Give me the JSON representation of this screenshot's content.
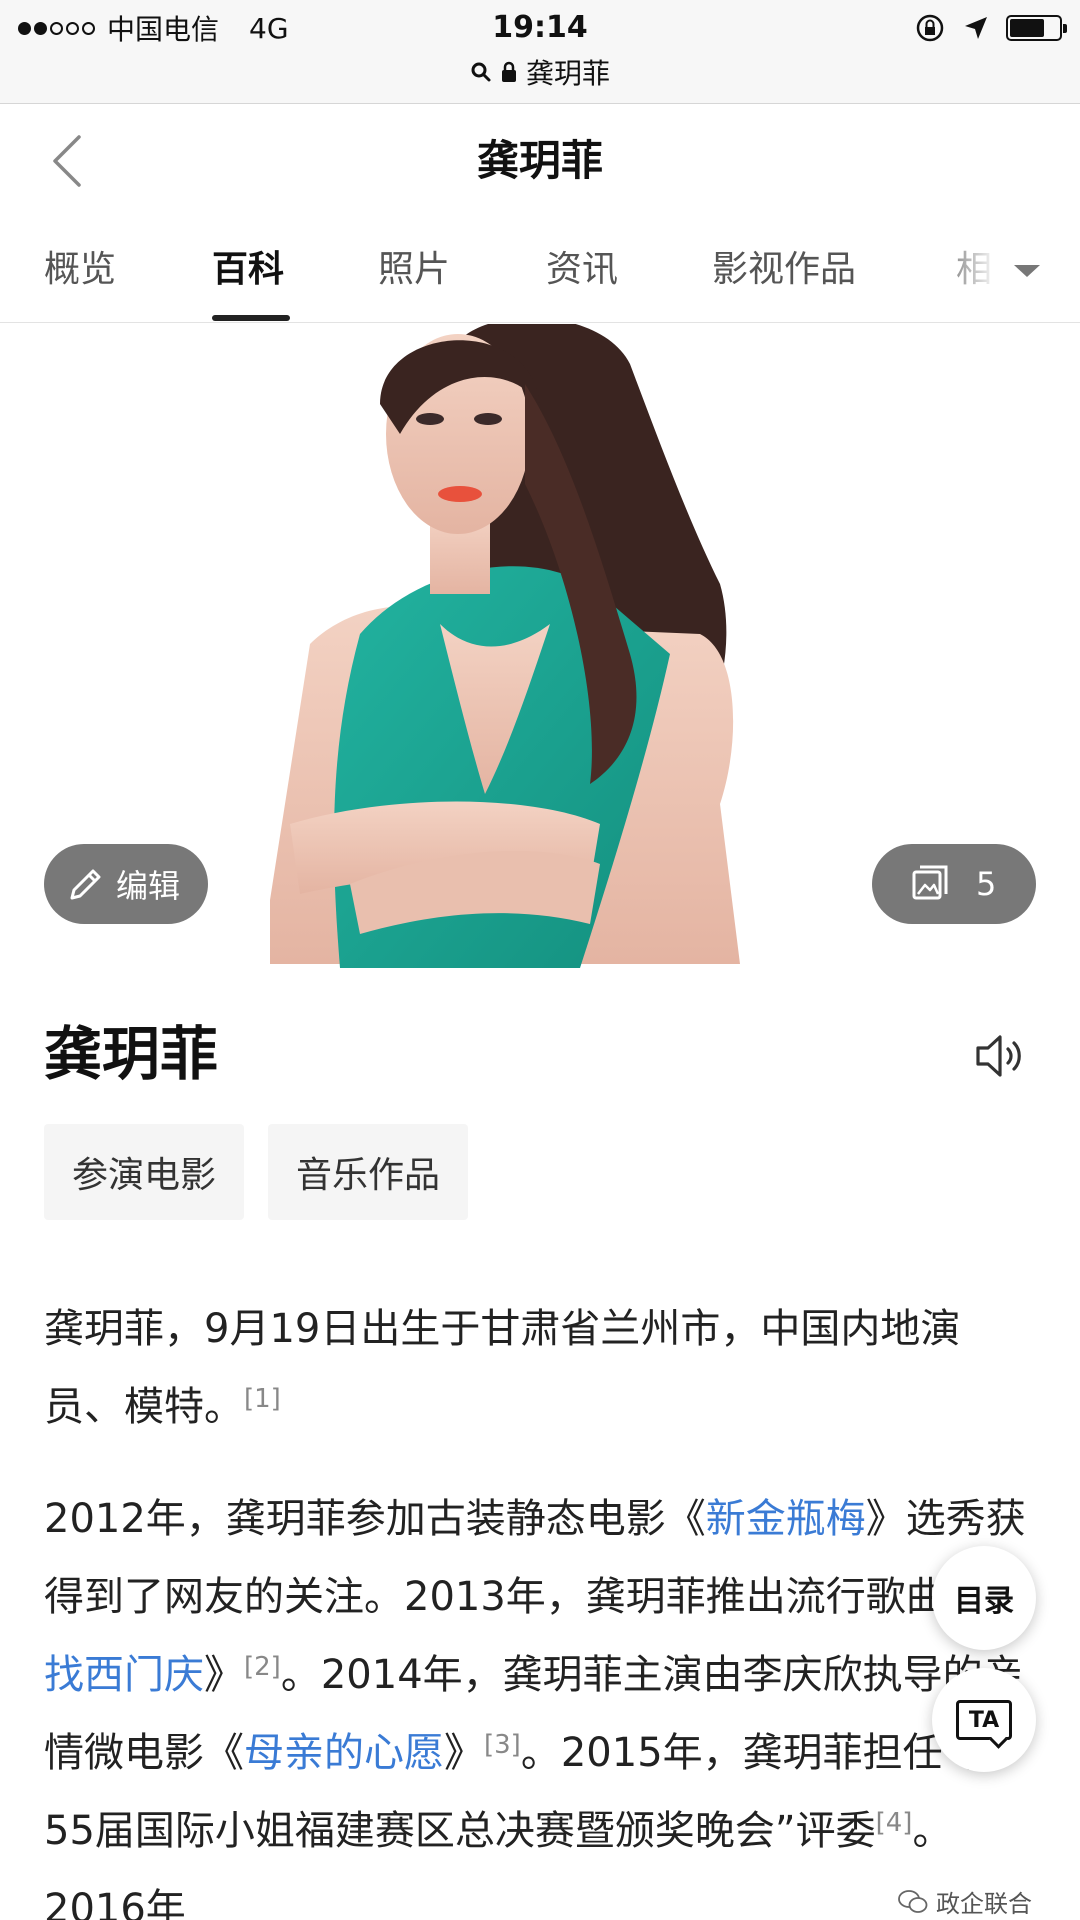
{
  "status_bar": {
    "carrier": "中国电信",
    "network": "4G",
    "time": "19:14",
    "battery_level": 0.7
  },
  "address_bar": {
    "text": "龚玥菲"
  },
  "nav": {
    "title": "龚玥菲"
  },
  "tabs": [
    {
      "label": "概览",
      "active": false
    },
    {
      "label": "百科",
      "active": true
    },
    {
      "label": "照片",
      "active": false
    },
    {
      "label": "资讯",
      "active": false
    },
    {
      "label": "影视作品",
      "active": false
    },
    {
      "label": "相",
      "active": false
    }
  ],
  "hero": {
    "edit_label": "编辑",
    "photo_count": "5"
  },
  "entry": {
    "title": "龚玥菲",
    "chips": [
      "参演电影",
      "音乐作品"
    ]
  },
  "article": {
    "p1_text": "龚玥菲，9月19日出生于甘肃省兰州市，中国内地演员、模特。",
    "p1_ref": "[1]",
    "p2": {
      "t1": "2012年，龚玥菲参加古装静态电影《",
      "l1": "新金瓶梅",
      "t2": "》选秀获得到了网友的关注。2013年，龚玥菲推出流行歌曲《",
      "l2": "寻找西门庆",
      "t3": "》",
      "r2": "[2]",
      "t4": "。2014年，龚玥菲主演由李庆欣执导的亲情微电影《",
      "l3": "母亲的心愿",
      "t5": "》",
      "r3": "[3]",
      "t6": "。2015年，龚玥菲担任“第55届国际小姐福建赛区总决赛暨颁奖晚会”评委",
      "r4": "[4]",
      "t7": "。2016年"
    }
  },
  "floating": {
    "toc_label": "目录",
    "ta_label": "TA"
  },
  "watermark": {
    "text": "政企联合"
  },
  "colors": {
    "link": "#3a7bd5",
    "pill_bg": "#5a5a5a",
    "chip_bg": "#f5f5f5",
    "dress_teal": "#1fae9a"
  },
  "icons": [
    "search-icon",
    "lock-icon",
    "back-arrow-icon",
    "pencil-icon",
    "gallery-icon",
    "speaker-icon",
    "chevron-down-icon",
    "wechat-icon",
    "location-arrow-icon",
    "orientation-lock-icon"
  ]
}
